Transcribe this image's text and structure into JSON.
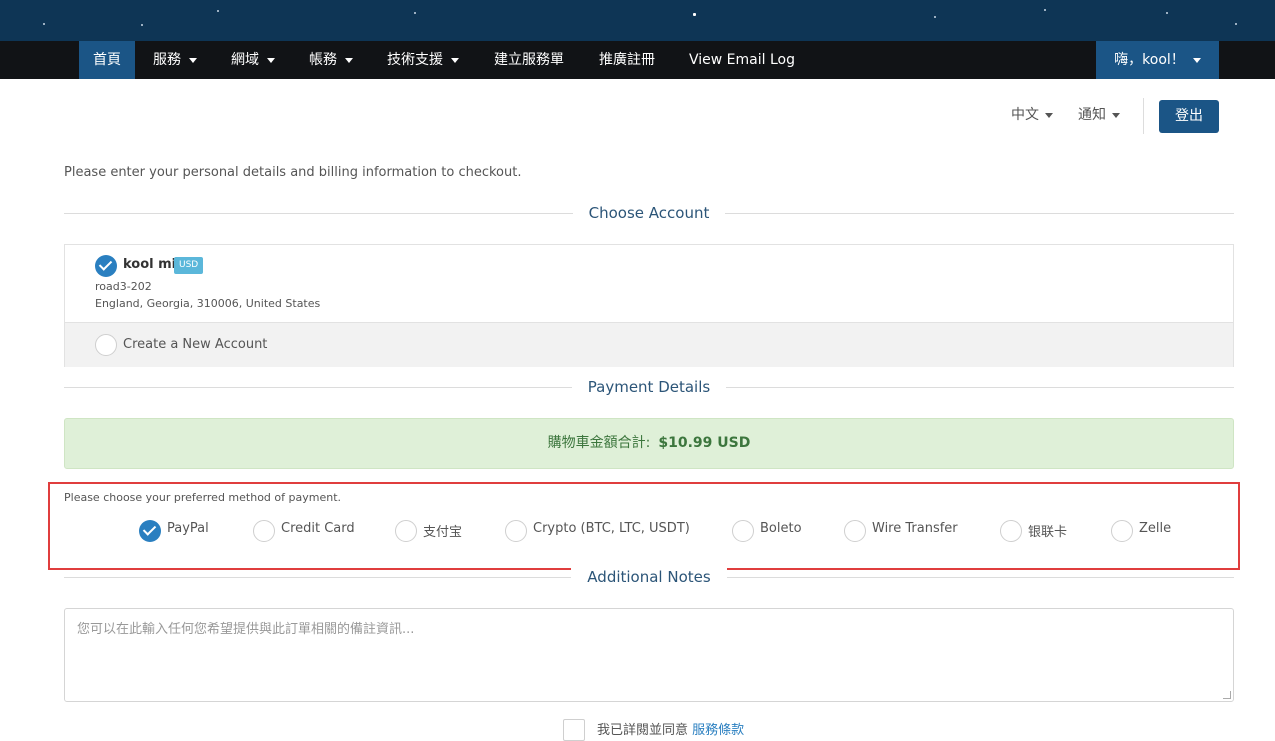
{
  "nav": {
    "items": [
      {
        "label": "首頁"
      },
      {
        "label": "服務"
      },
      {
        "label": "網域"
      },
      {
        "label": "帳務"
      },
      {
        "label": "技術支援"
      },
      {
        "label": "建立服務單"
      },
      {
        "label": "推廣註冊"
      },
      {
        "label": "View Email Log"
      }
    ],
    "user_label": "嗨，kool！"
  },
  "utility": {
    "language": "中文",
    "notifications": "通知",
    "logout": "登出"
  },
  "intro": "Please enter your personal details and billing information to checkout.",
  "sections": {
    "choose_account": "Choose Account",
    "payment_details": "Payment Details",
    "additional_notes": "Additional Notes"
  },
  "account": {
    "name": "kool mi",
    "currency_badge": "USD",
    "address1": "road3-202",
    "address2": "England, Georgia, 310006, United States",
    "create_new": "Create a New Account"
  },
  "cart_total": {
    "label": "購物車金額合計:",
    "amount": "$10.99 USD"
  },
  "payment": {
    "label": "Please choose your preferred method of payment.",
    "selected": "PayPal",
    "methods": [
      {
        "label": "PayPal"
      },
      {
        "label": "Credit Card"
      },
      {
        "label": "支付宝"
      },
      {
        "label": "Crypto (BTC, LTC, USDT)"
      },
      {
        "label": "Boleto"
      },
      {
        "label": "Wire Transfer"
      },
      {
        "label": "银联卡"
      },
      {
        "label": "Zelle"
      }
    ]
  },
  "notes": {
    "placeholder": "您可以在此輸入任何您希望提供與此訂單相關的備註資訊..."
  },
  "tos": {
    "text": "我已詳閱並同意",
    "link": "服務條款"
  },
  "colors": {
    "nav_bg": "#111316",
    "header_bg": "#0e3555",
    "accent": "#1b5586",
    "success_bg": "#dff0d8",
    "highlight": "#e03d3d"
  }
}
